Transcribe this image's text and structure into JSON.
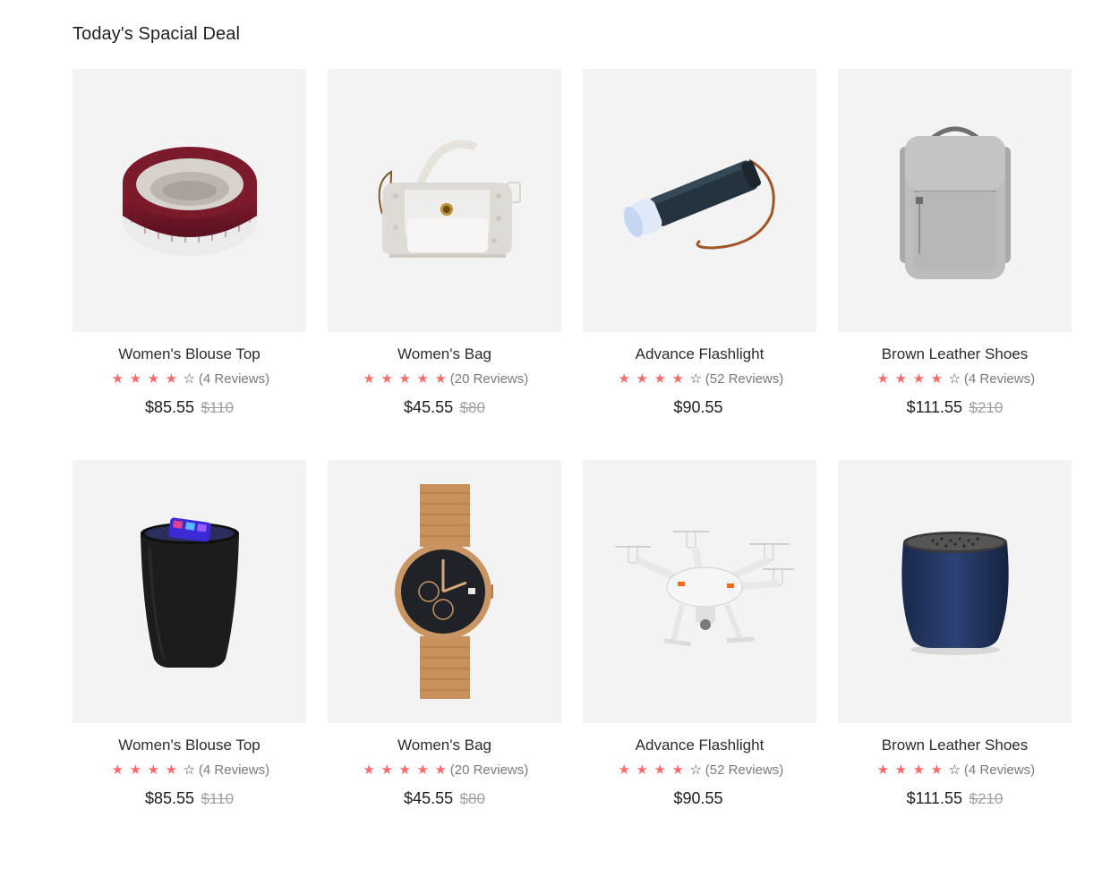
{
  "section": {
    "title": "Today's Spacial Deal"
  },
  "colors": {
    "star": "#ff6a6a",
    "card_bg": "#f3f3f3",
    "old_price": "#a0a0a0"
  },
  "products": [
    {
      "name": "Women's Blouse Top",
      "image_icon": "knit-headband-icon",
      "rating": 4,
      "max_rating": 5,
      "reviews": "(4 Reviews)",
      "price": "$85.55",
      "old_price": "$110"
    },
    {
      "name": "Women's Bag",
      "image_icon": "handbag-icon",
      "rating": 5,
      "max_rating": 5,
      "reviews": "(20 Reviews)",
      "price": "$45.55",
      "old_price": "$80"
    },
    {
      "name": "Advance Flashlight",
      "image_icon": "flashlight-icon",
      "rating": 4,
      "max_rating": 5,
      "reviews": "(52 Reviews)",
      "price": "$90.55",
      "old_price": ""
    },
    {
      "name": "Brown Leather Shoes",
      "image_icon": "backpack-icon",
      "rating": 4,
      "max_rating": 5,
      "reviews": "(4 Reviews)",
      "price": "$111.55",
      "old_price": "$210"
    },
    {
      "name": "Women's Blouse Top",
      "image_icon": "wireless-charger-cup-icon",
      "rating": 4,
      "max_rating": 5,
      "reviews": "(4 Reviews)",
      "price": "$85.55",
      "old_price": "$110"
    },
    {
      "name": "Women's Bag",
      "image_icon": "wristwatch-icon",
      "rating": 5,
      "max_rating": 5,
      "reviews": "(20 Reviews)",
      "price": "$45.55",
      "old_price": "$80"
    },
    {
      "name": "Advance Flashlight",
      "image_icon": "drone-icon",
      "rating": 4,
      "max_rating": 5,
      "reviews": "(52 Reviews)",
      "price": "$90.55",
      "old_price": ""
    },
    {
      "name": "Brown Leather Shoes",
      "image_icon": "speaker-icon",
      "rating": 4,
      "max_rating": 5,
      "reviews": "(4 Reviews)",
      "price": "$111.55",
      "old_price": "$210"
    }
  ]
}
